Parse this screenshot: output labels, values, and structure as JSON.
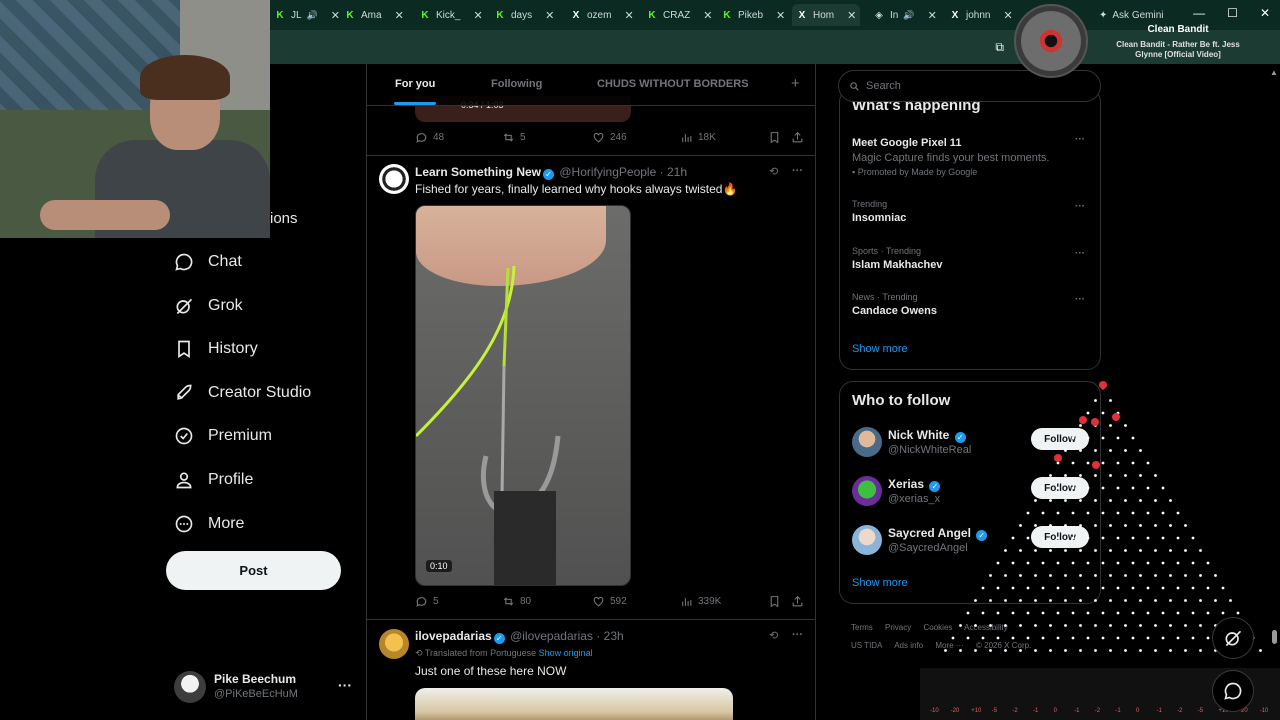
{
  "browser": {
    "tabs": [
      {
        "label": "JL",
        "favicon": "K"
      },
      {
        "label": "Ama",
        "favicon": "K"
      },
      {
        "label": "Kick_",
        "favicon": "K"
      },
      {
        "label": "days",
        "favicon": "K"
      },
      {
        "label": "ozem",
        "favicon": "X"
      },
      {
        "label": "CRAZ",
        "favicon": "K"
      },
      {
        "label": "Pikeb",
        "favicon": "K"
      },
      {
        "label": "Hom",
        "favicon": "X"
      },
      {
        "label": "In",
        "favicon": "shield"
      },
      {
        "label": "johnn",
        "favicon": "X"
      },
      {
        "label": "Ask Gemini",
        "favicon": "gem"
      }
    ],
    "close_glyph": "✕"
  },
  "music": {
    "title": "Clean Bandit",
    "subtitle": "Clean Bandit - Rather Be ft. Jess Glynne [Official Video]"
  },
  "nav": {
    "peek_label": "ions",
    "items": [
      {
        "label": "Chat",
        "icon": "chat-icon"
      },
      {
        "label": "Grok",
        "icon": "grok-icon"
      },
      {
        "label": "History",
        "icon": "bookmark-icon"
      },
      {
        "label": "Creator Studio",
        "icon": "rocket-icon"
      },
      {
        "label": "Premium",
        "icon": "verified-badge-icon"
      },
      {
        "label": "Profile",
        "icon": "person-icon"
      },
      {
        "label": "More",
        "icon": "more-circle-icon"
      }
    ],
    "post_label": "Post",
    "account": {
      "name": "Pike Beechum",
      "handle": "@PiKeBeEcHuM",
      "more": "···"
    }
  },
  "feed": {
    "tabs": [
      {
        "label": "For you",
        "active": true
      },
      {
        "label": "Following",
        "active": false
      },
      {
        "label": "CHUDS WITHOUT BORDERS",
        "active": false
      }
    ],
    "add_tab": "+",
    "prev_post": {
      "video_time": "0:34 / 1:03",
      "replies": "48",
      "reposts": "5",
      "likes": "246",
      "views": "18K"
    },
    "posts": [
      {
        "name": "Learn Something New",
        "handle": "@HorifyingPeople",
        "time": "21h",
        "text": "Fished for years, finally learned why hooks always twisted🔥",
        "video_duration": "0:10",
        "replies": "5",
        "reposts": "80",
        "likes": "592",
        "views": "339K"
      },
      {
        "name": "ilovepadarias",
        "handle": "@ilovepadarias",
        "time": "23h",
        "translated_label": "Translated from Portuguese",
        "show_original": "Show original",
        "text": "Just one of these here NOW"
      }
    ]
  },
  "sidebar": {
    "search_placeholder": "Search",
    "happening": {
      "title": "What's happening",
      "trends": [
        {
          "name": "Meet Google Pixel 11",
          "desc": "Magic Capture finds your best moments.",
          "promo": "Promoted by Made by Google"
        },
        {
          "category": "Trending",
          "name": "Insomniac"
        },
        {
          "category": "Sports · Trending",
          "name": "Islam Makhachev"
        },
        {
          "category": "News · Trending",
          "name": "Candace Owens"
        }
      ],
      "show_more": "Show more"
    },
    "who_to_follow": {
      "title": "Who to follow",
      "users": [
        {
          "name": "Nick White",
          "handle": "@NickWhiteReal",
          "button": "Follow"
        },
        {
          "name": "Xerias",
          "handle": "@xerias_x",
          "button": "Follow"
        },
        {
          "name": "Saycred Angel",
          "handle": "@SaycredAngel",
          "button": "Follow"
        }
      ],
      "show_more": "Show more"
    },
    "footer": [
      "Terms",
      "Privacy",
      "Cookies",
      "Accessibility",
      "US TIDA",
      "Ads info",
      "More ···",
      "© 2026 X Corp."
    ]
  },
  "plinko": {
    "multipliers": [
      "-10",
      "-20",
      "+10",
      "-5",
      "-2",
      "-1",
      "0",
      "-1",
      "-2",
      "-1",
      "0",
      "-1",
      "-2",
      "-5",
      "+10",
      "-20",
      "-10"
    ]
  },
  "colors": {
    "accent": "#1d9bf0",
    "background": "#000000",
    "border": "#2f3336",
    "muted": "#71767b",
    "kick_green": "#53fc18"
  }
}
